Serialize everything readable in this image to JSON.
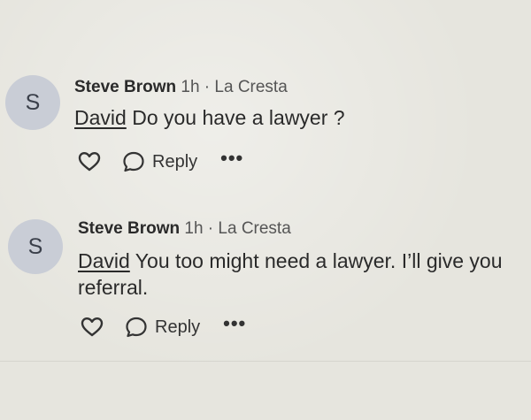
{
  "comments": [
    {
      "avatar_initial": "S",
      "author": "Steve Brown",
      "time": "1h",
      "separator": "·",
      "location": "La Cresta",
      "mention": "David",
      "text": "Do you have a lawyer ?",
      "reply_label": "Reply",
      "more_label": "•••"
    },
    {
      "avatar_initial": "S",
      "author": "Steve Brown",
      "time": "1h",
      "separator": "·",
      "location": "La Cresta",
      "mention": "David",
      "text": "You too might need a lawyer.  I’ll give you referral.",
      "reply_label": "Reply",
      "more_label": "•••"
    }
  ]
}
